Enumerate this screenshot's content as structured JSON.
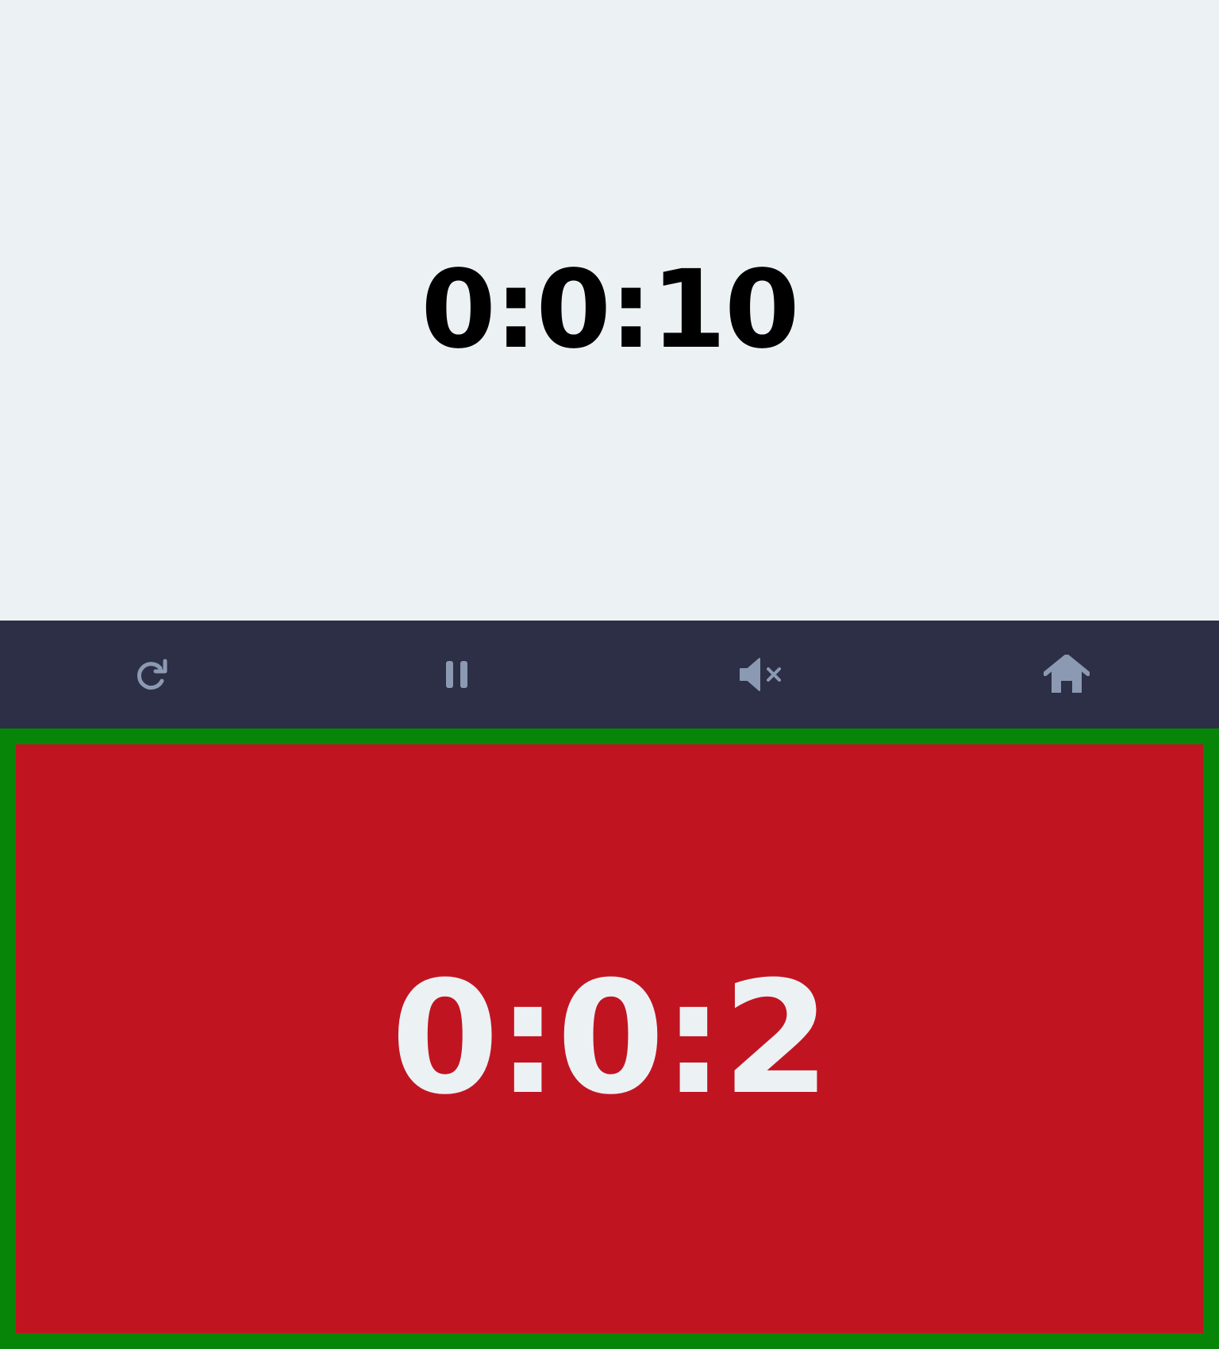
{
  "player_top": {
    "time": "0:0:10",
    "background": "#ecf1f4",
    "text_color": "#000000"
  },
  "controls": {
    "background": "#2c2f45",
    "icon_color": "#8b9ab2",
    "buttons": [
      {
        "icon": "reset-icon"
      },
      {
        "icon": "pause-icon"
      },
      {
        "icon": "mute-icon"
      },
      {
        "icon": "home-icon"
      }
    ]
  },
  "player_bottom": {
    "time": "0:0:2",
    "active": true,
    "background": "#c11421",
    "border_color": "#078509",
    "text_color": "#ecf1f4"
  }
}
